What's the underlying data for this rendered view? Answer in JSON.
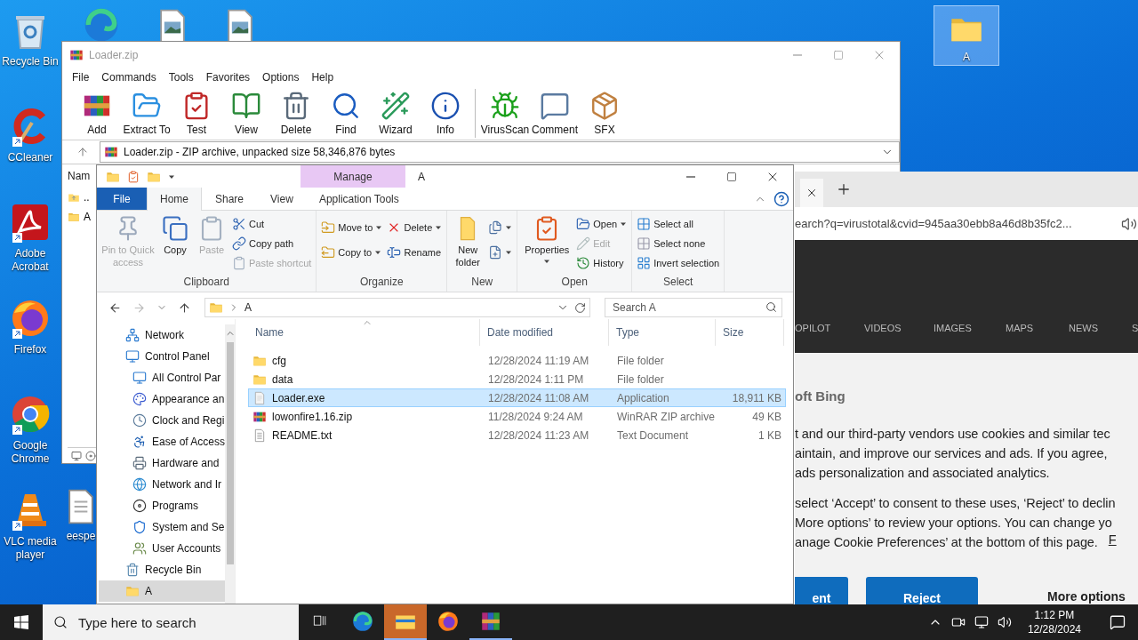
{
  "desktop": {
    "icons": [
      {
        "label": "Recycle Bin",
        "kind": "recycle",
        "shortcut": false
      },
      {
        "label": "CCleaner",
        "kind": "ccleaner",
        "shortcut": true
      },
      {
        "label": "Adobe Acrobat",
        "kind": "acrobat",
        "shortcut": true
      },
      {
        "label": "Firefox",
        "kind": "firefox",
        "shortcut": true
      },
      {
        "label": "Google Chrome",
        "kind": "chrome",
        "shortcut": true
      },
      {
        "label": "VLC media player",
        "kind": "vlc",
        "shortcut": true
      }
    ],
    "hidden_icons": [
      {
        "kind": "edge"
      },
      {
        "kind": "image"
      },
      {
        "kind": "image"
      },
      {
        "kind": "doc",
        "label": "eespe"
      }
    ],
    "folder_icon": {
      "label": "A",
      "selected": true
    }
  },
  "winrar": {
    "title": "Loader.zip",
    "menu": [
      "File",
      "Commands",
      "Tools",
      "Favorites",
      "Options",
      "Help"
    ],
    "toolbar_groups": [
      [
        {
          "label": "Add",
          "kind": "add"
        },
        {
          "label": "Extract To",
          "kind": "extract"
        },
        {
          "label": "Test",
          "kind": "test"
        },
        {
          "label": "View",
          "kind": "view"
        },
        {
          "label": "Delete",
          "kind": "delete"
        },
        {
          "label": "Find",
          "kind": "find"
        },
        {
          "label": "Wizard",
          "kind": "wizard"
        },
        {
          "label": "Info",
          "kind": "info"
        }
      ],
      [
        {
          "label": "VirusScan",
          "kind": "virusscan"
        },
        {
          "label": "Comment",
          "kind": "comment"
        },
        {
          "label": "SFX",
          "kind": "sfx"
        }
      ]
    ],
    "path": "Loader.zip - ZIP archive, unpacked size 58,346,876 bytes",
    "column": "Nam",
    "rows": [
      {
        "name": "..",
        "kind": "up"
      },
      {
        "name": "A",
        "kind": "folder"
      }
    ]
  },
  "explorer": {
    "title": "A",
    "context_tab": "Manage",
    "tabs": [
      {
        "label": "File",
        "kind": "file",
        "selected": false
      },
      {
        "label": "Home",
        "kind": "tab",
        "selected": true
      },
      {
        "label": "Share",
        "kind": "tab",
        "selected": false
      },
      {
        "label": "View",
        "kind": "tab",
        "selected": false
      },
      {
        "label": "Application Tools",
        "kind": "context",
        "selected": false
      }
    ],
    "groups": [
      {
        "name": "Clipboard",
        "columns": [
          {
            "kind": "large",
            "items": [
              {
                "label": "Pin to Quick access",
                "kind": "pin",
                "disabled": true,
                "dropdown": false
              }
            ]
          },
          {
            "kind": "large",
            "items": [
              {
                "label": "Copy",
                "kind": "copy",
                "disabled": false,
                "dropdown": false
              }
            ]
          },
          {
            "kind": "large",
            "items": [
              {
                "label": "Paste",
                "kind": "paste",
                "disabled": true,
                "dropdown": false
              }
            ]
          },
          {
            "kind": "stack",
            "items": [
              {
                "label": "Cut",
                "kind": "cut",
                "disabled": false,
                "dropdown": false
              },
              {
                "label": "Copy path",
                "kind": "copypath",
                "disabled": false,
                "dropdown": false
              },
              {
                "label": "Paste shortcut",
                "kind": "pasteshortcut",
                "disabled": true,
                "dropdown": false
              }
            ]
          }
        ]
      },
      {
        "name": "Organize",
        "columns": [
          {
            "kind": "stack",
            "items": [
              {
                "label": "Move to",
                "kind": "moveto",
                "disabled": false,
                "dropdown": true
              },
              {
                "label": "Copy to",
                "kind": "copyto",
                "disabled": false,
                "dropdown": true
              }
            ]
          },
          {
            "kind": "stack",
            "items": [
              {
                "label": "Delete",
                "kind": "delete",
                "disabled": false,
                "dropdown": true
              },
              {
                "label": "Rename",
                "kind": "rename",
                "disabled": false,
                "dropdown": false
              }
            ]
          }
        ]
      },
      {
        "name": "New",
        "columns": [
          {
            "kind": "large",
            "items": [
              {
                "label": "New folder",
                "kind": "newfolder",
                "disabled": false,
                "dropdown": false
              }
            ]
          },
          {
            "kind": "stack",
            "items": [
              {
                "kind": "newitem",
                "disabled": false,
                "dropdown": true
              },
              {
                "kind": "easyaccess",
                "disabled": false,
                "dropdown": true
              }
            ]
          }
        ]
      },
      {
        "name": "Open",
        "columns": [
          {
            "kind": "large",
            "items": [
              {
                "label": "Properties",
                "kind": "properties",
                "disabled": false,
                "dropdown": true
              }
            ]
          },
          {
            "kind": "stack",
            "items": [
              {
                "label": "Open",
                "kind": "open",
                "disabled": false,
                "dropdown": true
              },
              {
                "label": "Edit",
                "kind": "edit",
                "disabled": true,
                "dropdown": false
              },
              {
                "label": "History",
                "kind": "history",
                "disabled": false,
                "dropdown": false
              }
            ]
          }
        ]
      },
      {
        "name": "Select",
        "columns": [
          {
            "kind": "stack",
            "items": [
              {
                "label": "Select all",
                "kind": "selectall",
                "disabled": false,
                "dropdown": false
              },
              {
                "label": "Select none",
                "kind": "selectnone",
                "disabled": false,
                "dropdown": false
              },
              {
                "label": "Invert selection",
                "kind": "invert",
                "disabled": false,
                "dropdown": false
              }
            ]
          }
        ]
      }
    ],
    "address": [
      "A"
    ],
    "search": {
      "placeholder": "Search A"
    },
    "nav": [
      {
        "label": "Network",
        "kind": "network",
        "selected": false
      },
      {
        "label": "Control Panel",
        "kind": "control",
        "selected": false,
        "children": [
          {
            "label": "All Control Par",
            "kind": "control",
            "selected": false
          },
          {
            "label": "Appearance an",
            "kind": "appearance",
            "selected": false
          },
          {
            "label": "Clock and Regi",
            "kind": "clock",
            "selected": false
          },
          {
            "label": "Ease of Access",
            "kind": "ease",
            "selected": false
          },
          {
            "label": "Hardware and",
            "kind": "hardware",
            "selected": false
          },
          {
            "label": "Network and Ir",
            "kind": "internet",
            "selected": false
          },
          {
            "label": "Programs",
            "kind": "programs",
            "selected": false
          },
          {
            "label": "System and Se",
            "kind": "system",
            "selected": false
          },
          {
            "label": "User Accounts",
            "kind": "users",
            "selected": false
          }
        ]
      },
      {
        "label": "Recycle Bin",
        "kind": "recycle",
        "selected": false
      },
      {
        "label": "A",
        "kind": "folder",
        "selected": true
      }
    ],
    "columns": [
      "Name",
      "Date modified",
      "Type",
      "Size"
    ],
    "files": [
      {
        "name": "cfg",
        "kind": "folder",
        "date": "12/28/2024 11:19 AM",
        "type": "File folder",
        "selected": false
      },
      {
        "name": "data",
        "kind": "folder",
        "date": "12/28/2024 1:11 PM",
        "type": "File folder",
        "selected": false
      },
      {
        "name": "Loader.exe",
        "kind": "exe",
        "date": "12/28/2024 11:08 AM",
        "type": "Application",
        "size": "18,911 KB",
        "selected": true
      },
      {
        "name": "lowonfire1.16.zip",
        "kind": "rar",
        "date": "11/28/2024 9:24 AM",
        "type": "WinRAR ZIP archive",
        "size": "49 KB",
        "selected": false
      },
      {
        "name": "README.txt",
        "kind": "txt",
        "date": "12/28/2024 11:23 AM",
        "type": "Text Document",
        "size": "1 KB",
        "selected": false
      }
    ]
  },
  "browser": {
    "address": "earch?q=virustotal&cvid=945aa30ebb8a46d8b35fc2...",
    "nav": [
      "OPILOT",
      "VIDEOS",
      "IMAGES",
      "MAPS",
      "NEWS",
      "S"
    ],
    "dialog": {
      "title": "oft Bing",
      "paragraphs": [
        [
          "t and our third-party vendors use cookies and similar tec",
          "aintain, and improve our services and ads. If you agree,",
          "ads personalization and associated analytics."
        ],
        [
          "select ‘Accept’ to consent to these uses, ‘Reject’ to declin",
          "More options’ to review your options. You can change yo",
          "anage Cookie Preferences’ at the bottom of this page."
        ]
      ],
      "link": "F",
      "buttons": [
        {
          "label": "ent",
          "kind": "primary"
        },
        {
          "label": "Reject",
          "kind": "primary"
        },
        {
          "label": "More options",
          "kind": "text"
        }
      ]
    }
  },
  "taskbar": {
    "search": {
      "placeholder": "Type here to search"
    },
    "apps": [
      {
        "kind": "taskview",
        "selected": false,
        "running": false
      },
      {
        "kind": "edge",
        "selected": false,
        "running": false
      },
      {
        "kind": "explorer",
        "selected": true,
        "running": true
      },
      {
        "kind": "firefox",
        "selected": false,
        "running": false
      },
      {
        "kind": "winrar",
        "selected": false,
        "running": true
      }
    ],
    "time": "1:12 PM",
    "date": "12/28/2024"
  }
}
